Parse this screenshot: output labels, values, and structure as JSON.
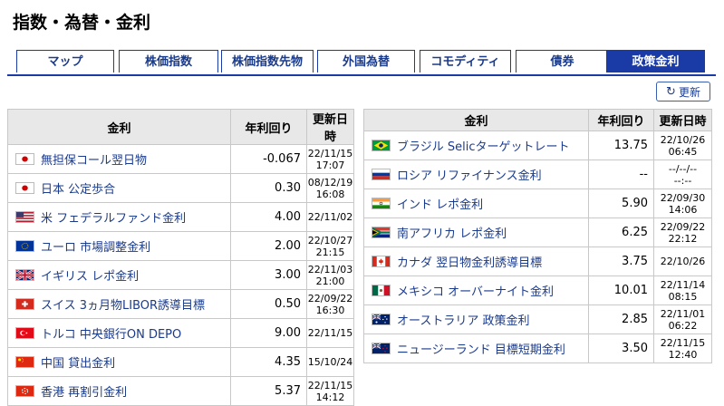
{
  "page": {
    "title": "指数・為替・金利"
  },
  "tabs": [
    {
      "label": "マップ",
      "active": false
    },
    {
      "label": "株価指数",
      "active": false
    },
    {
      "label": "株価指数先物",
      "active": false
    },
    {
      "label": "外国為替",
      "active": false
    },
    {
      "label": "コモディティ",
      "active": false
    },
    {
      "label": "債券",
      "active": false
    },
    {
      "label": "政策金利",
      "active": true
    }
  ],
  "refresh": {
    "label": "更新",
    "icon": "refresh-icon"
  },
  "headers": {
    "name": "金利",
    "rate": "年利回り",
    "updated": "更新日時"
  },
  "left_rows": [
    {
      "flag": "jp",
      "name": "無担保コール翌日物",
      "rate": "-0.067",
      "date": "22/11/15",
      "time": "17:07"
    },
    {
      "flag": "jp",
      "name": "日本 公定歩合",
      "rate": "0.30",
      "date": "08/12/19",
      "time": "16:08"
    },
    {
      "flag": "us",
      "name": "米 フェデラルファンド金利",
      "rate": "4.00",
      "date": "22/11/02",
      "time": ""
    },
    {
      "flag": "eu",
      "name": "ユーロ 市場調整金利",
      "rate": "2.00",
      "date": "22/10/27",
      "time": "21:15"
    },
    {
      "flag": "gb",
      "name": "イギリス レポ金利",
      "rate": "3.00",
      "date": "22/11/03",
      "time": "21:00"
    },
    {
      "flag": "ch",
      "name": "スイス 3ヵ月物LIBOR誘導目標",
      "rate": "0.50",
      "date": "22/09/22",
      "time": "16:30"
    },
    {
      "flag": "tr",
      "name": "トルコ 中央銀行ON DEPO",
      "rate": "9.00",
      "date": "22/11/15",
      "time": ""
    },
    {
      "flag": "cn",
      "name": "中国 貸出金利",
      "rate": "4.35",
      "date": "15/10/24",
      "time": ""
    },
    {
      "flag": "hk",
      "name": "香港 再割引金利",
      "rate": "5.37",
      "date": "22/11/15",
      "time": "14:12"
    }
  ],
  "right_rows": [
    {
      "flag": "br",
      "name": "ブラジル Selicターゲットレート",
      "rate": "13.75",
      "date": "22/10/26",
      "time": "06:45"
    },
    {
      "flag": "ru",
      "name": "ロシア リファイナンス金利",
      "rate": "--",
      "date": "--/--/--",
      "time": "--:--"
    },
    {
      "flag": "in",
      "name": "インド レポ金利",
      "rate": "5.90",
      "date": "22/09/30",
      "time": "14:06"
    },
    {
      "flag": "za",
      "name": "南アフリカ レポ金利",
      "rate": "6.25",
      "date": "22/09/22",
      "time": "22:12"
    },
    {
      "flag": "ca",
      "name": "カナダ 翌日物金利誘導目標",
      "rate": "3.75",
      "date": "22/10/26",
      "time": ""
    },
    {
      "flag": "mx",
      "name": "メキシコ オーバーナイト金利",
      "rate": "10.01",
      "date": "22/11/14",
      "time": "08:15"
    },
    {
      "flag": "au",
      "name": "オーストラリア 政策金利",
      "rate": "2.85",
      "date": "22/11/01",
      "time": "06:22"
    },
    {
      "flag": "nz",
      "name": "ニュージーランド 目標短期金利",
      "rate": "3.50",
      "date": "22/11/15",
      "time": "12:40"
    }
  ]
}
